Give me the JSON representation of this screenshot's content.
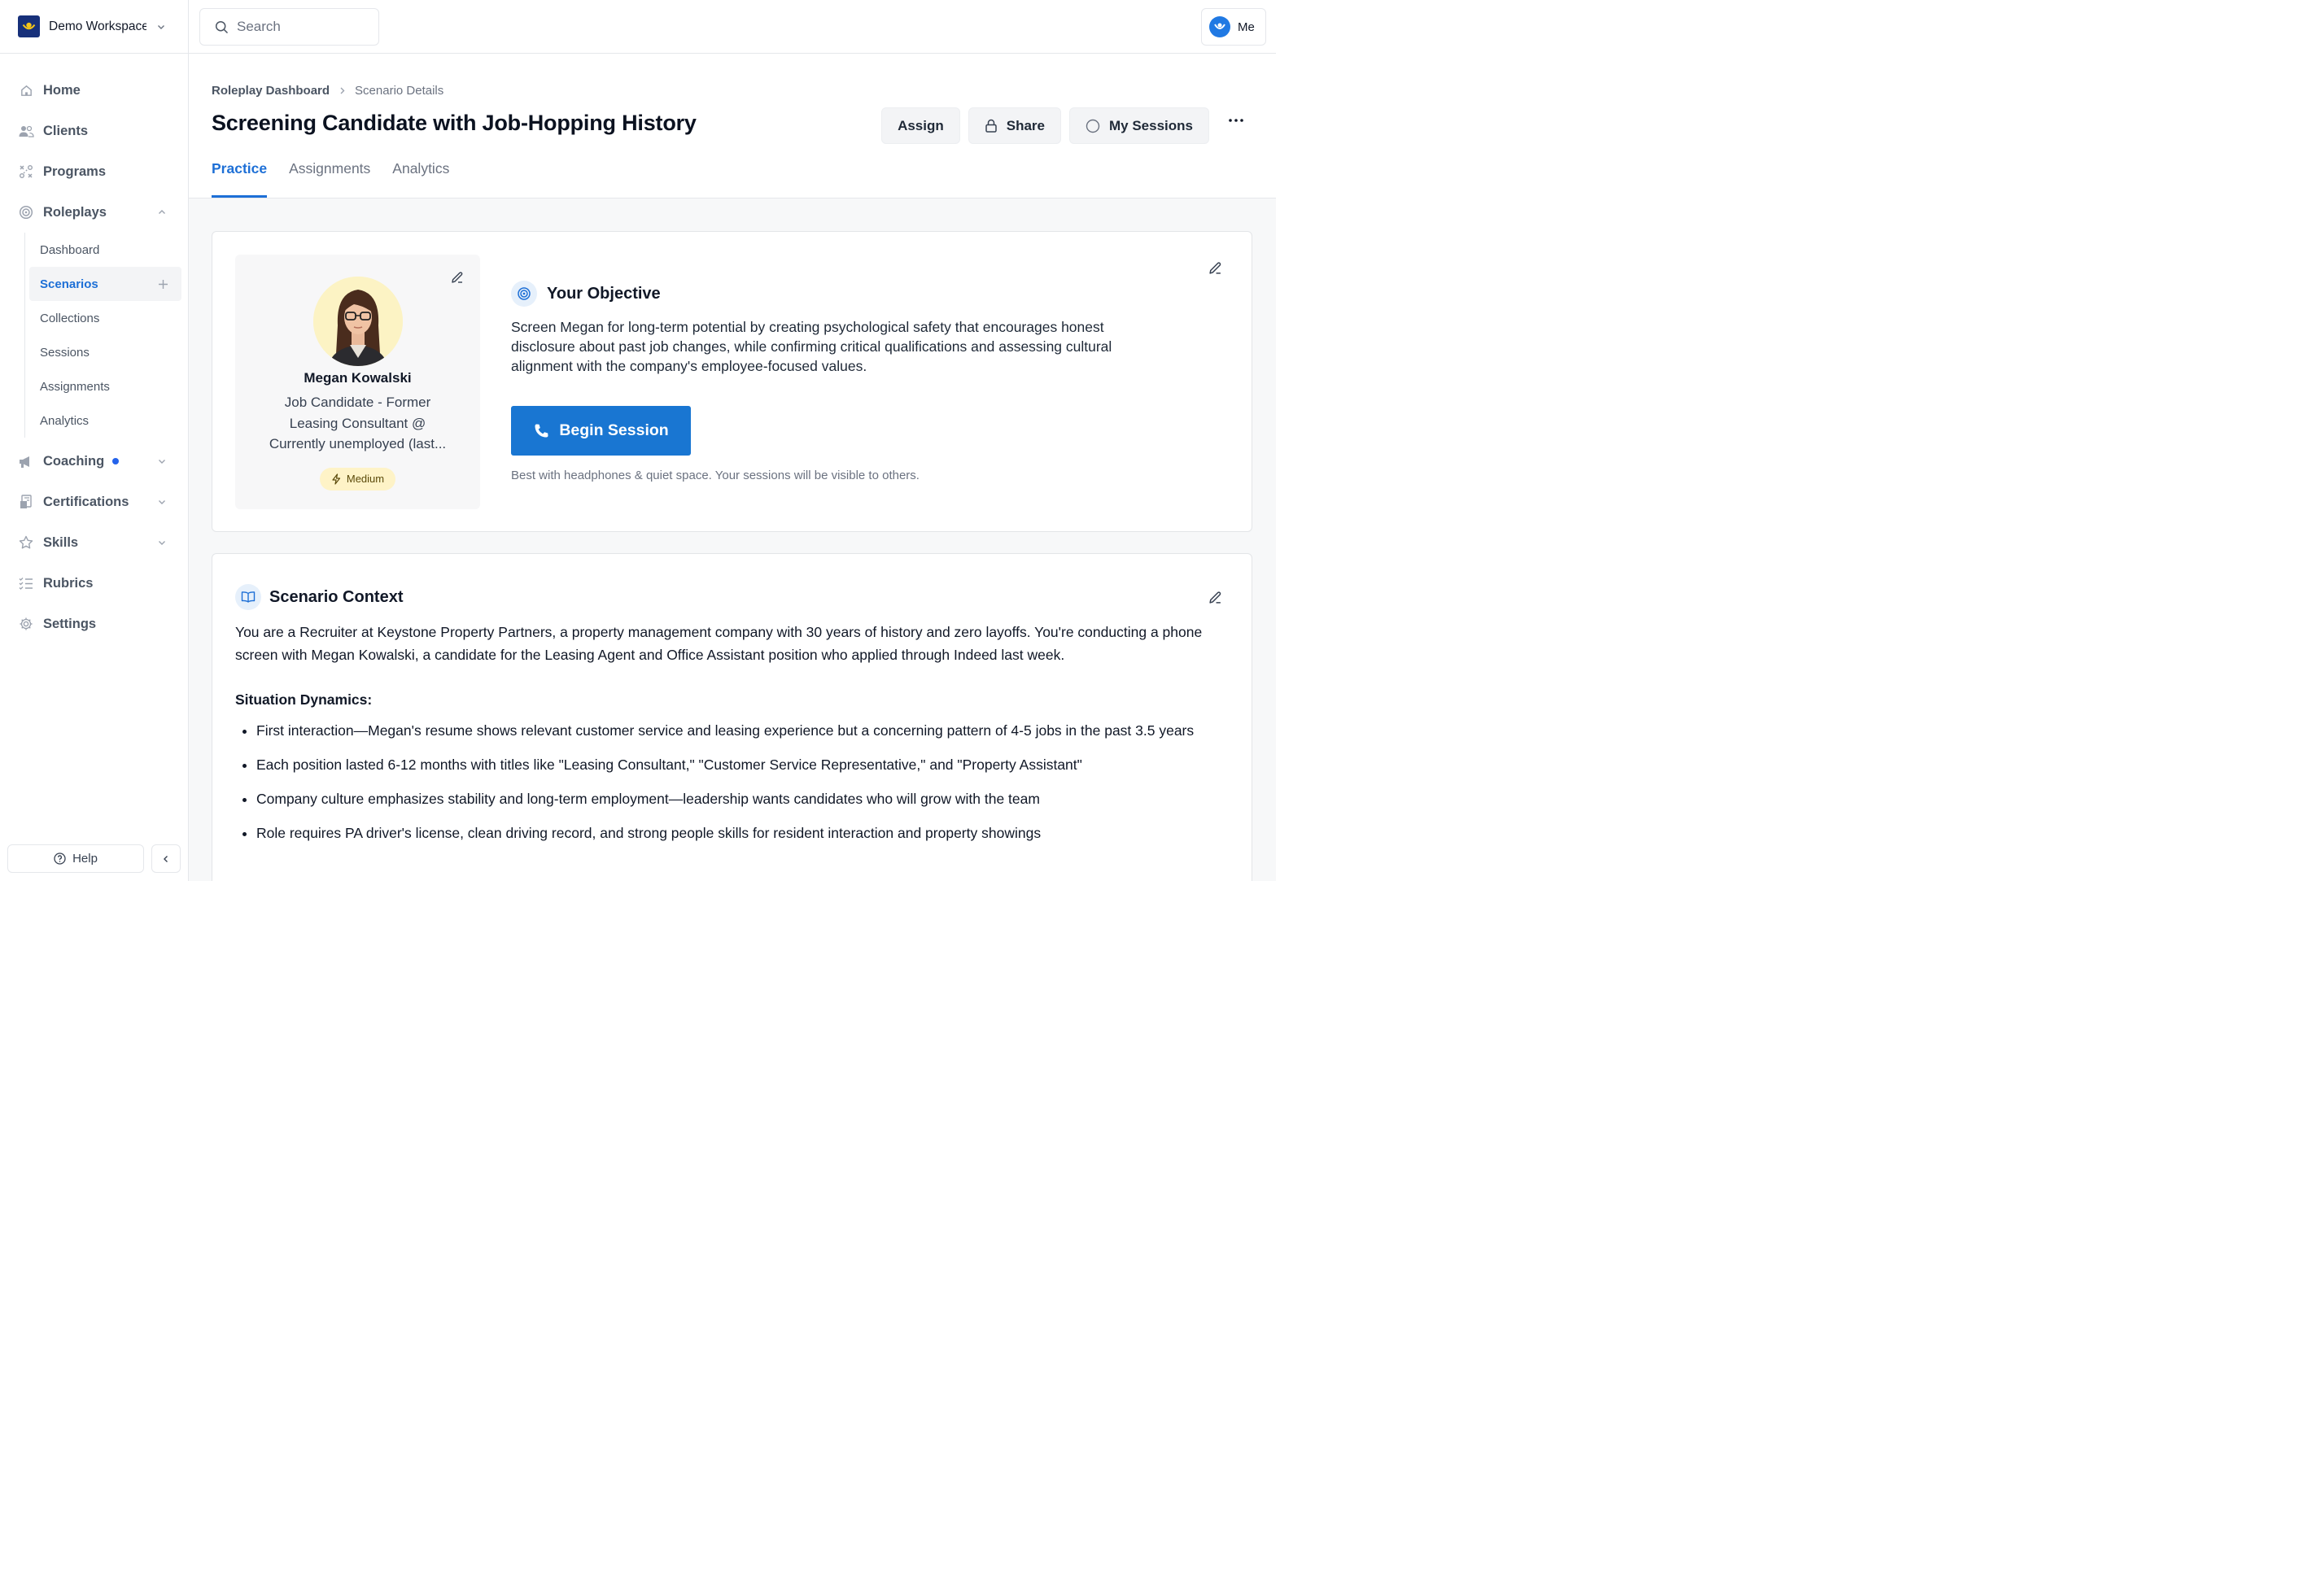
{
  "workspace": {
    "name": "Demo Workspace"
  },
  "search": {
    "placeholder": "Search"
  },
  "user": {
    "label": "Me"
  },
  "sidebar": {
    "items": [
      {
        "label": "Home",
        "icon": "home-icon"
      },
      {
        "label": "Clients",
        "icon": "clients-icon"
      },
      {
        "label": "Programs",
        "icon": "programs-icon"
      },
      {
        "label": "Roleplays",
        "icon": "target-icon"
      },
      {
        "label": "Coaching",
        "icon": "megaphone-icon"
      },
      {
        "label": "Certifications",
        "icon": "certificate-icon"
      },
      {
        "label": "Skills",
        "icon": "star-icon"
      },
      {
        "label": "Rubrics",
        "icon": "list-check-icon"
      },
      {
        "label": "Settings",
        "icon": "gear-icon"
      }
    ],
    "roleplays_sub": [
      "Dashboard",
      "Scenarios",
      "Collections",
      "Sessions",
      "Assignments",
      "Analytics"
    ],
    "active_sub": "Scenarios",
    "help_label": "Help"
  },
  "breadcrumb": {
    "root": "Roleplay Dashboard",
    "current": "Scenario Details"
  },
  "page": {
    "title": "Screening Candidate with Job-Hopping History"
  },
  "actions": {
    "assign": "Assign",
    "share": "Share",
    "sessions": "My Sessions"
  },
  "tabs": [
    "Practice",
    "Assignments",
    "Analytics"
  ],
  "active_tab": "Practice",
  "persona": {
    "name": "Megan Kowalski",
    "role_lines": [
      "Job Candidate - Former",
      "Leasing Consultant @",
      "Currently unemployed (last..."
    ],
    "difficulty": "Medium"
  },
  "objective": {
    "title": "Your Objective",
    "text": "Screen Megan for long-term potential by creating psychological safety that encourages honest disclosure about past job changes, while confirming critical qualifications and assessing cultural alignment with the company's employee-focused values.",
    "button": "Begin Session",
    "hint": "Best with headphones & quiet space. Your sessions will be visible to others."
  },
  "context": {
    "title": "Scenario Context",
    "intro": "You are a Recruiter at Keystone Property Partners, a property management company with 30 years of history and zero layoffs. You're conducting a phone screen with Megan Kowalski, a candidate for the Leasing Agent and Office Assistant position who applied through Indeed last week.",
    "dynamics_title": "Situation Dynamics:",
    "dynamics": [
      "First interaction—Megan's resume shows relevant customer service and leasing experience but a concerning pattern of 4-5 jobs in the past 3.5 years",
      "Each position lasted 6-12 months with titles like \"Leasing Consultant,\" \"Customer Service Representative,\" and \"Property Assistant\"",
      "Company culture emphasizes stability and long-term employment—leadership wants candidates who will grow with the team",
      "Role requires PA driver's license, clean driving record, and strong people skills for resident interaction and property showings"
    ]
  },
  "colors": {
    "accent": "#1d6fd6",
    "button": "#1976d2",
    "workspace_logo": "#17307a",
    "badge_bg": "#fef3c7"
  }
}
